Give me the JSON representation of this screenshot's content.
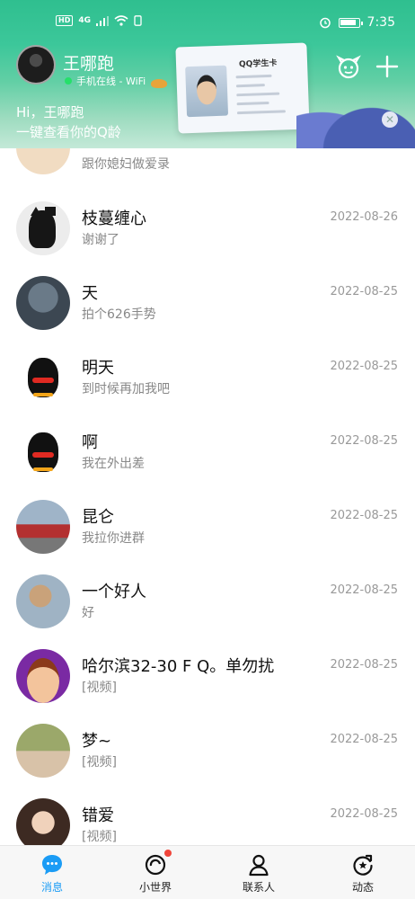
{
  "status_bar": {
    "left_badge": "HD",
    "network": "4G",
    "time": "7:35"
  },
  "header": {
    "user_name": "王哪跑",
    "online_status": "手机在线 - WiFi",
    "greeting": "Hi，王哪跑",
    "promo_text": "一键查看你的Q龄",
    "card_title": "QQ学生卡"
  },
  "partial_row": {
    "message": "跟你媳妇做爱录"
  },
  "conversations": [
    {
      "name": "枝蔓缠心",
      "message": "谢谢了",
      "date": "2022-08-26",
      "avatar": "cat"
    },
    {
      "name": "天",
      "message": "拍个626手势",
      "date": "2022-08-25",
      "avatar": "driver"
    },
    {
      "name": "明天",
      "message": "到时候再加我吧",
      "date": "2022-08-25",
      "avatar": "penguin"
    },
    {
      "name": "啊",
      "message": "我在外出差",
      "date": "2022-08-25",
      "avatar": "penguin"
    },
    {
      "name": "昆仑",
      "message": "我拉你进群",
      "date": "2022-08-25",
      "avatar": "car"
    },
    {
      "name": "一个好人",
      "message": "好",
      "date": "2022-08-25",
      "avatar": "fantasy"
    },
    {
      "name": "哈尔滨32-30 F Q。单勿扰",
      "message": "[视频]",
      "date": "2022-08-25",
      "avatar": "anime"
    },
    {
      "name": "梦~",
      "message": "[视频]",
      "date": "2022-08-25",
      "avatar": "legs"
    },
    {
      "name": "错爱",
      "message": "[视频]",
      "date": "2022-08-25",
      "avatar": "girl"
    }
  ],
  "bottom_nav": {
    "tabs": [
      {
        "label": "消息",
        "icon": "chat-bubble-icon",
        "active": true
      },
      {
        "label": "小世界",
        "icon": "planet-icon",
        "badge": true
      },
      {
        "label": "联系人",
        "icon": "contact-icon"
      },
      {
        "label": "动态",
        "icon": "refresh-star-icon"
      }
    ]
  },
  "colors": {
    "accent": "#1b9cf5",
    "header_green": "#3cc79a",
    "badge_red": "#f0453a"
  }
}
